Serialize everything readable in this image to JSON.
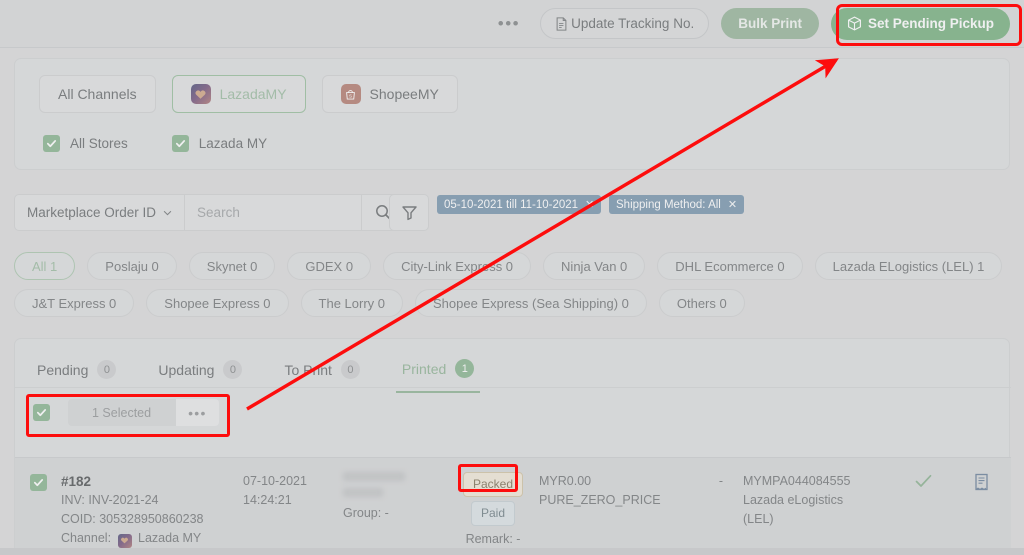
{
  "toolbar": {
    "more_label": "•••",
    "update_tracking_label": "Update Tracking No.",
    "bulk_print_label": "Bulk Print",
    "set_pending_pickup_label": "Set Pending Pickup",
    "accent_green": "#3fc252",
    "annotation_red": "#fd0d0d"
  },
  "channels": {
    "all_channels_label": "All Channels",
    "lazada_label": "LazadaMY",
    "shopee_label": "ShopeeMY",
    "stores": [
      {
        "label": "All Stores",
        "checked": true
      },
      {
        "label": "Lazada MY",
        "checked": true
      }
    ]
  },
  "search": {
    "field_label": "Marketplace Order ID",
    "placeholder": "Search",
    "value": "",
    "chips": [
      {
        "label": "05-10-2021 till 11-10-2021",
        "close": "✕"
      },
      {
        "label": "Shipping Method: All",
        "close": "✕"
      }
    ]
  },
  "couriers": {
    "row1": [
      {
        "label": "All 1",
        "active": true
      },
      {
        "label": "Poslaju 0",
        "active": false
      },
      {
        "label": "Skynet 0",
        "active": false
      },
      {
        "label": "GDEX 0",
        "active": false
      },
      {
        "label": "City-Link Express 0",
        "active": false
      },
      {
        "label": "Ninja Van 0",
        "active": false
      },
      {
        "label": "DHL Ecommerce 0",
        "active": false
      },
      {
        "label": "Lazada ELogistics (LEL) 1",
        "active": false
      }
    ],
    "row2": [
      {
        "label": "J&T Express 0",
        "active": false
      },
      {
        "label": "Shopee Express 0",
        "active": false
      },
      {
        "label": "The Lorry 0",
        "active": false
      },
      {
        "label": "Shopee Express (Sea Shipping) 0",
        "active": false
      },
      {
        "label": "Others 0",
        "active": false
      }
    ]
  },
  "tabs": [
    {
      "label": "Pending",
      "count": "0",
      "active": false
    },
    {
      "label": "Updating",
      "count": "0",
      "active": false
    },
    {
      "label": "To Print",
      "count": "0",
      "active": false
    },
    {
      "label": "Printed",
      "count": "1",
      "active": true
    }
  ],
  "selection": {
    "checked": true,
    "count_label": "1 Selected",
    "more_label": "•••"
  },
  "order": {
    "checked": true,
    "id": "#182",
    "inv": "INV: INV-2021-24",
    "coid": "COID: 305328950860238",
    "channel_prefix": "Channel:",
    "channel_name": "Lazada MY",
    "date": "07-10-2021",
    "time": "14:24:21",
    "customer_group": "Group: -",
    "status": "Packed",
    "payment": "Paid",
    "remark": "Remark: -",
    "price": "MYR0.00",
    "sku": "PURE_ZERO_PRICE",
    "dash": "-",
    "tracking_no": "MYMPA044084555",
    "courier_line1": "Lazada eLogistics",
    "courier_line2": "(LEL)"
  }
}
